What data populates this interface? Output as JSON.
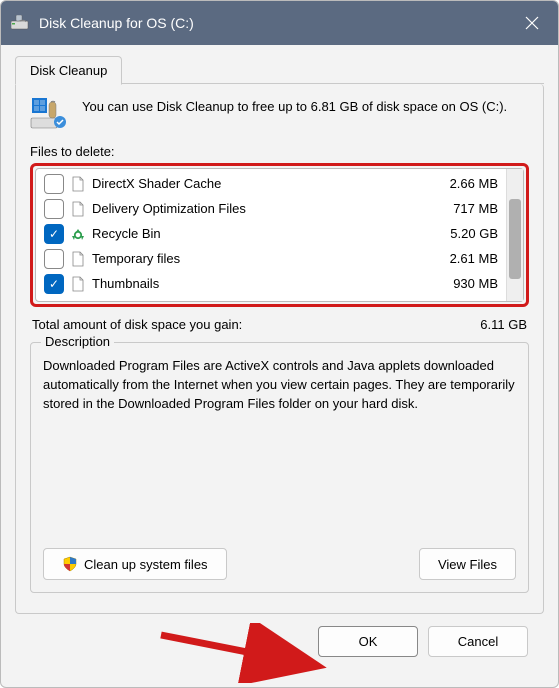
{
  "titlebar": {
    "title": "Disk Cleanup for OS (C:)"
  },
  "tab": {
    "label": "Disk Cleanup"
  },
  "intro": "You can use Disk Cleanup to free up to 6.81 GB of disk space on OS (C:).",
  "files_label": "Files to delete:",
  "files": [
    {
      "name": "DirectX Shader Cache",
      "size": "2.66 MB",
      "checked": false,
      "icon": "file"
    },
    {
      "name": "Delivery Optimization Files",
      "size": "717 MB",
      "checked": false,
      "icon": "file"
    },
    {
      "name": "Recycle Bin",
      "size": "5.20 GB",
      "checked": true,
      "icon": "recycle"
    },
    {
      "name": "Temporary files",
      "size": "2.61 MB",
      "checked": false,
      "icon": "file"
    },
    {
      "name": "Thumbnails",
      "size": "930 MB",
      "checked": true,
      "icon": "file"
    }
  ],
  "total": {
    "label": "Total amount of disk space you gain:",
    "value": "6.11 GB"
  },
  "description": {
    "legend": "Description",
    "text": "Downloaded Program Files are ActiveX controls and Java applets downloaded automatically from the Internet when you view certain pages. They are temporarily stored in the Downloaded Program Files folder on your hard disk."
  },
  "buttons": {
    "cleanup": "Clean up system files",
    "view": "View Files",
    "ok": "OK",
    "cancel": "Cancel"
  }
}
